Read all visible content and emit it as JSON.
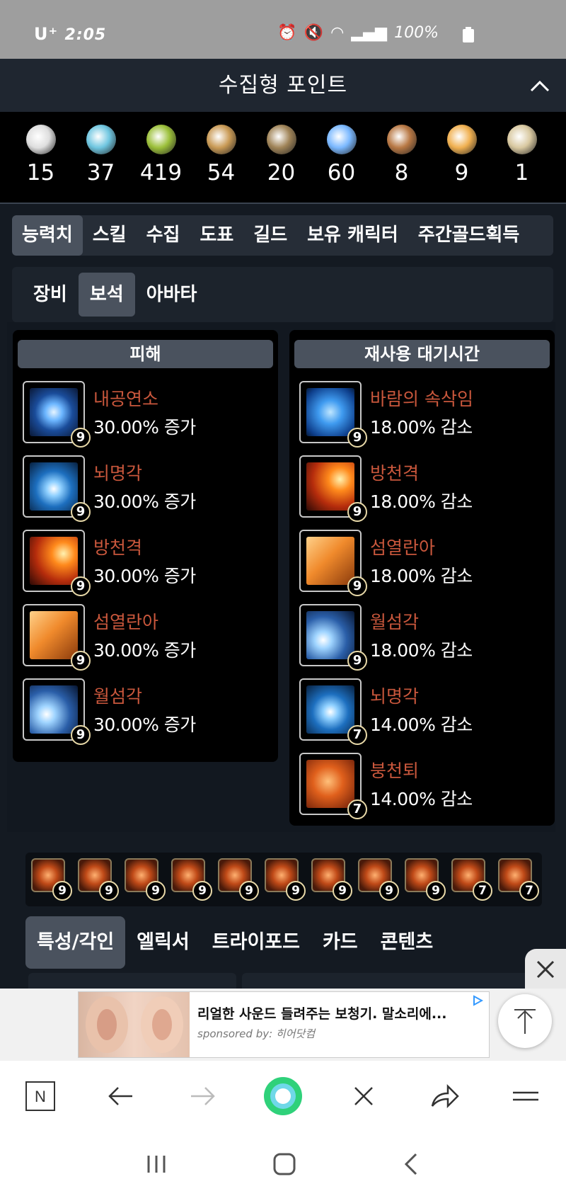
{
  "status_bar": {
    "carrier": "U⁺",
    "time": "2:05",
    "battery": "100%"
  },
  "header": {
    "title": "수집형 포인트"
  },
  "collection_points": [
    {
      "icon": "heart-organ-icon",
      "count": "15",
      "color": "#dedede"
    },
    {
      "icon": "island-orb-icon",
      "count": "37",
      "color": "#6fc6e0"
    },
    {
      "icon": "seed-sprout-icon",
      "count": "419",
      "color": "#9cc03a"
    },
    {
      "icon": "map-scroll-icon",
      "count": "54",
      "color": "#c99a55"
    },
    {
      "icon": "telescope-icon",
      "count": "20",
      "color": "#a08458"
    },
    {
      "icon": "leaf-star-icon",
      "count": "60",
      "color": "#7ab8ff"
    },
    {
      "icon": "crest-icon",
      "count": "8",
      "color": "#b87844"
    },
    {
      "icon": "compass-star-icon",
      "count": "9",
      "color": "#f0b050"
    },
    {
      "icon": "medal-icon",
      "count": "1",
      "color": "#d8c8a0"
    }
  ],
  "main_tabs": [
    "능력치",
    "스킬",
    "수집",
    "도표",
    "길드",
    "보유 캐릭터",
    "주간골드획득"
  ],
  "sub_tabs": [
    "장비",
    "보석",
    "아바타"
  ],
  "damage": {
    "title": "피해",
    "items": [
      {
        "name": "내공연소",
        "value": "30.00% 증가",
        "level": "9"
      },
      {
        "name": "뇌명각",
        "value": "30.00% 증가",
        "level": "9"
      },
      {
        "name": "방천격",
        "value": "30.00% 증가",
        "level": "9"
      },
      {
        "name": "섬열란아",
        "value": "30.00% 증가",
        "level": "9"
      },
      {
        "name": "월섬각",
        "value": "30.00% 증가",
        "level": "9"
      }
    ]
  },
  "cooldown": {
    "title": "재사용 대기시간",
    "items": [
      {
        "name": "바람의 속삭임",
        "value": "18.00% 감소",
        "level": "9"
      },
      {
        "name": "방천격",
        "value": "18.00% 감소",
        "level": "9"
      },
      {
        "name": "섬열란아",
        "value": "18.00% 감소",
        "level": "9"
      },
      {
        "name": "월섬각",
        "value": "18.00% 감소",
        "level": "9"
      },
      {
        "name": "뇌명각",
        "value": "14.00% 감소",
        "level": "7"
      },
      {
        "name": "붕천퇴",
        "value": "14.00% 감소",
        "level": "7"
      }
    ]
  },
  "gem_strip": [
    "9",
    "9",
    "9",
    "9",
    "9",
    "9",
    "9",
    "9",
    "9",
    "7",
    "7"
  ],
  "bottom_tabs": [
    "특성/각인",
    "엘릭서",
    "트라이포드",
    "카드",
    "콘텐츠"
  ],
  "ad": {
    "title": "리얼한 사운드 들려주는 보청기. 말소리에...",
    "sponsor": "sponsored by: 히어닷컴"
  },
  "browser": {
    "n_label": "N"
  }
}
